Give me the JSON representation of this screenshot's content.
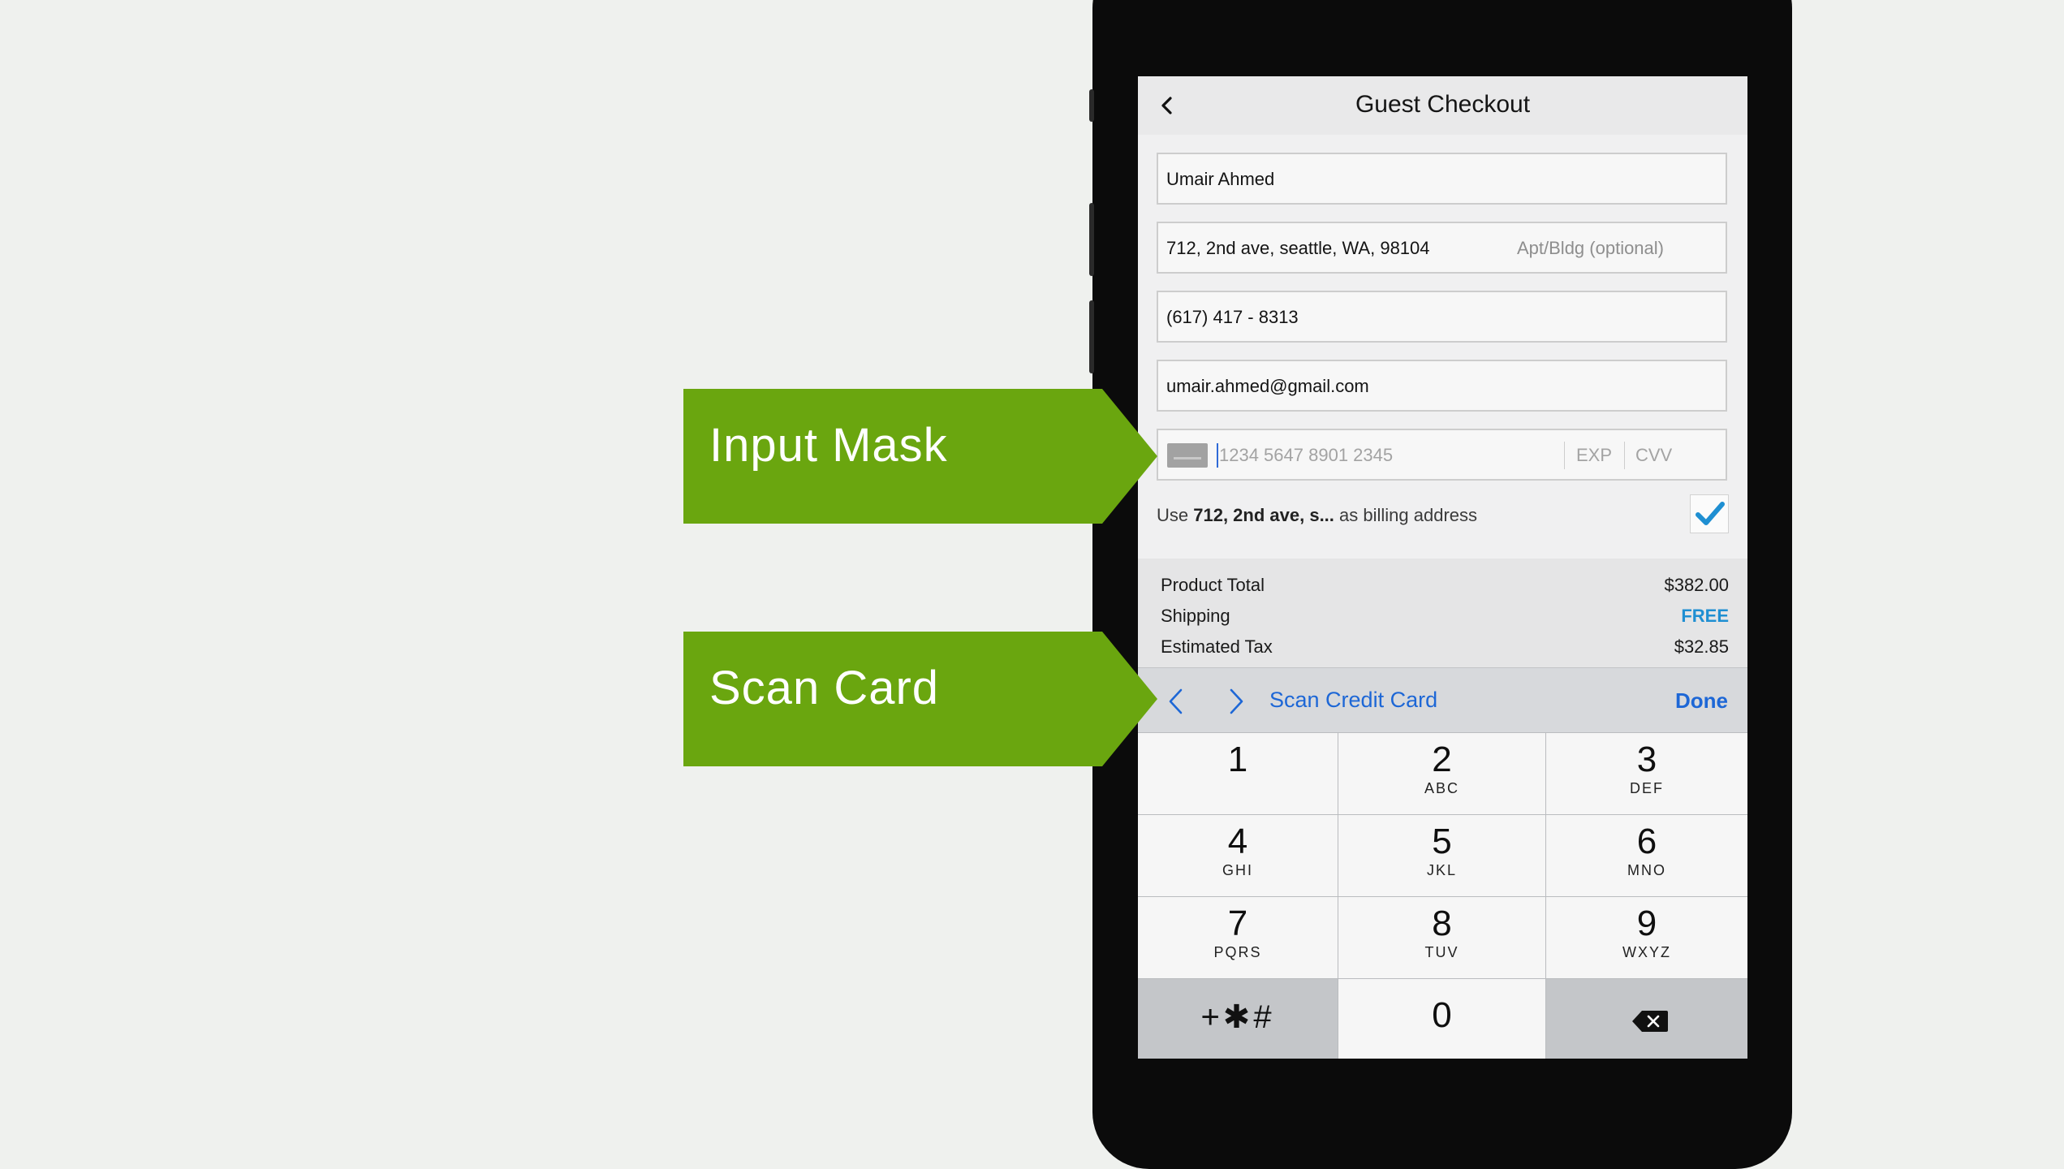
{
  "screen": {
    "title": "Guest Checkout",
    "back_icon": "chevron-left-icon"
  },
  "form": {
    "name_value": "Umair Ahmed",
    "address_value": "712, 2nd ave, seattle, WA, 98104",
    "apt_placeholder": "Apt/Bldg (optional)",
    "phone_value": "(617) 417 - 8313",
    "email_value": "umair.ahmed@gmail.com",
    "card_number_placeholder": "1234 5647 8901 2345",
    "exp_placeholder": "EXP",
    "cvv_placeholder": "CVV",
    "card_icon": "credit-card-icon",
    "billing_prefix": "Use ",
    "billing_address": "712, 2nd ave, s...",
    "billing_suffix": " as billing address",
    "billing_checked": true,
    "checkmark_color": "#1f8fd2"
  },
  "totals": {
    "product_total_label": "Product Total",
    "product_total_value": "$382.00",
    "shipping_label": "Shipping",
    "shipping_value": "FREE",
    "tax_label": "Estimated Tax",
    "tax_value": "$32.85"
  },
  "keyboard_toolbar": {
    "scan_label": "Scan Credit Card",
    "done_label": "Done",
    "accent_color": "#1d67d6"
  },
  "keypad": {
    "keys": [
      {
        "num": "1",
        "letters": ""
      },
      {
        "num": "2",
        "letters": "ABC"
      },
      {
        "num": "3",
        "letters": "DEF"
      },
      {
        "num": "4",
        "letters": "GHI"
      },
      {
        "num": "5",
        "letters": "JKL"
      },
      {
        "num": "6",
        "letters": "MNO"
      },
      {
        "num": "7",
        "letters": "PQRS"
      },
      {
        "num": "8",
        "letters": "TUV"
      },
      {
        "num": "9",
        "letters": "WXYZ"
      }
    ],
    "symbols_label": "+✱#",
    "zero_label": "0",
    "delete_icon": "backspace-icon"
  },
  "callouts": {
    "input_mask": "Input Mask",
    "scan_card": "Scan Card",
    "color": "#6aa60f"
  }
}
